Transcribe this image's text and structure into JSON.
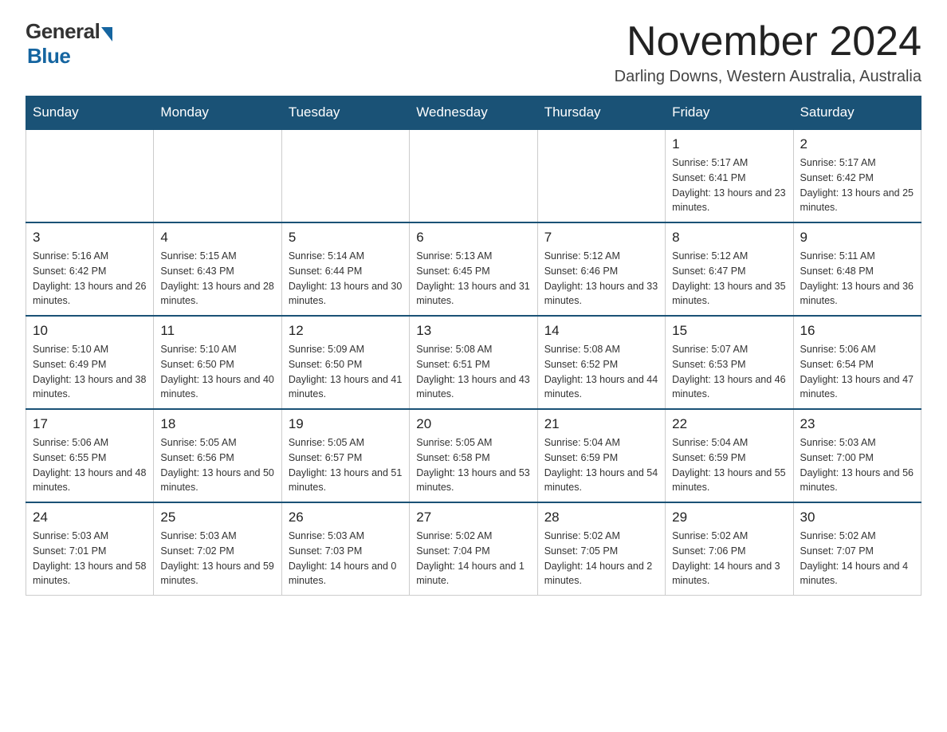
{
  "logo": {
    "general": "General",
    "blue": "Blue"
  },
  "title": "November 2024",
  "subtitle": "Darling Downs, Western Australia, Australia",
  "days_of_week": [
    "Sunday",
    "Monday",
    "Tuesday",
    "Wednesday",
    "Thursday",
    "Friday",
    "Saturday"
  ],
  "weeks": [
    [
      {
        "day": "",
        "info": ""
      },
      {
        "day": "",
        "info": ""
      },
      {
        "day": "",
        "info": ""
      },
      {
        "day": "",
        "info": ""
      },
      {
        "day": "",
        "info": ""
      },
      {
        "day": "1",
        "info": "Sunrise: 5:17 AM\nSunset: 6:41 PM\nDaylight: 13 hours and 23 minutes."
      },
      {
        "day": "2",
        "info": "Sunrise: 5:17 AM\nSunset: 6:42 PM\nDaylight: 13 hours and 25 minutes."
      }
    ],
    [
      {
        "day": "3",
        "info": "Sunrise: 5:16 AM\nSunset: 6:42 PM\nDaylight: 13 hours and 26 minutes."
      },
      {
        "day": "4",
        "info": "Sunrise: 5:15 AM\nSunset: 6:43 PM\nDaylight: 13 hours and 28 minutes."
      },
      {
        "day": "5",
        "info": "Sunrise: 5:14 AM\nSunset: 6:44 PM\nDaylight: 13 hours and 30 minutes."
      },
      {
        "day": "6",
        "info": "Sunrise: 5:13 AM\nSunset: 6:45 PM\nDaylight: 13 hours and 31 minutes."
      },
      {
        "day": "7",
        "info": "Sunrise: 5:12 AM\nSunset: 6:46 PM\nDaylight: 13 hours and 33 minutes."
      },
      {
        "day": "8",
        "info": "Sunrise: 5:12 AM\nSunset: 6:47 PM\nDaylight: 13 hours and 35 minutes."
      },
      {
        "day": "9",
        "info": "Sunrise: 5:11 AM\nSunset: 6:48 PM\nDaylight: 13 hours and 36 minutes."
      }
    ],
    [
      {
        "day": "10",
        "info": "Sunrise: 5:10 AM\nSunset: 6:49 PM\nDaylight: 13 hours and 38 minutes."
      },
      {
        "day": "11",
        "info": "Sunrise: 5:10 AM\nSunset: 6:50 PM\nDaylight: 13 hours and 40 minutes."
      },
      {
        "day": "12",
        "info": "Sunrise: 5:09 AM\nSunset: 6:50 PM\nDaylight: 13 hours and 41 minutes."
      },
      {
        "day": "13",
        "info": "Sunrise: 5:08 AM\nSunset: 6:51 PM\nDaylight: 13 hours and 43 minutes."
      },
      {
        "day": "14",
        "info": "Sunrise: 5:08 AM\nSunset: 6:52 PM\nDaylight: 13 hours and 44 minutes."
      },
      {
        "day": "15",
        "info": "Sunrise: 5:07 AM\nSunset: 6:53 PM\nDaylight: 13 hours and 46 minutes."
      },
      {
        "day": "16",
        "info": "Sunrise: 5:06 AM\nSunset: 6:54 PM\nDaylight: 13 hours and 47 minutes."
      }
    ],
    [
      {
        "day": "17",
        "info": "Sunrise: 5:06 AM\nSunset: 6:55 PM\nDaylight: 13 hours and 48 minutes."
      },
      {
        "day": "18",
        "info": "Sunrise: 5:05 AM\nSunset: 6:56 PM\nDaylight: 13 hours and 50 minutes."
      },
      {
        "day": "19",
        "info": "Sunrise: 5:05 AM\nSunset: 6:57 PM\nDaylight: 13 hours and 51 minutes."
      },
      {
        "day": "20",
        "info": "Sunrise: 5:05 AM\nSunset: 6:58 PM\nDaylight: 13 hours and 53 minutes."
      },
      {
        "day": "21",
        "info": "Sunrise: 5:04 AM\nSunset: 6:59 PM\nDaylight: 13 hours and 54 minutes."
      },
      {
        "day": "22",
        "info": "Sunrise: 5:04 AM\nSunset: 6:59 PM\nDaylight: 13 hours and 55 minutes."
      },
      {
        "day": "23",
        "info": "Sunrise: 5:03 AM\nSunset: 7:00 PM\nDaylight: 13 hours and 56 minutes."
      }
    ],
    [
      {
        "day": "24",
        "info": "Sunrise: 5:03 AM\nSunset: 7:01 PM\nDaylight: 13 hours and 58 minutes."
      },
      {
        "day": "25",
        "info": "Sunrise: 5:03 AM\nSunset: 7:02 PM\nDaylight: 13 hours and 59 minutes."
      },
      {
        "day": "26",
        "info": "Sunrise: 5:03 AM\nSunset: 7:03 PM\nDaylight: 14 hours and 0 minutes."
      },
      {
        "day": "27",
        "info": "Sunrise: 5:02 AM\nSunset: 7:04 PM\nDaylight: 14 hours and 1 minute."
      },
      {
        "day": "28",
        "info": "Sunrise: 5:02 AM\nSunset: 7:05 PM\nDaylight: 14 hours and 2 minutes."
      },
      {
        "day": "29",
        "info": "Sunrise: 5:02 AM\nSunset: 7:06 PM\nDaylight: 14 hours and 3 minutes."
      },
      {
        "day": "30",
        "info": "Sunrise: 5:02 AM\nSunset: 7:07 PM\nDaylight: 14 hours and 4 minutes."
      }
    ]
  ]
}
